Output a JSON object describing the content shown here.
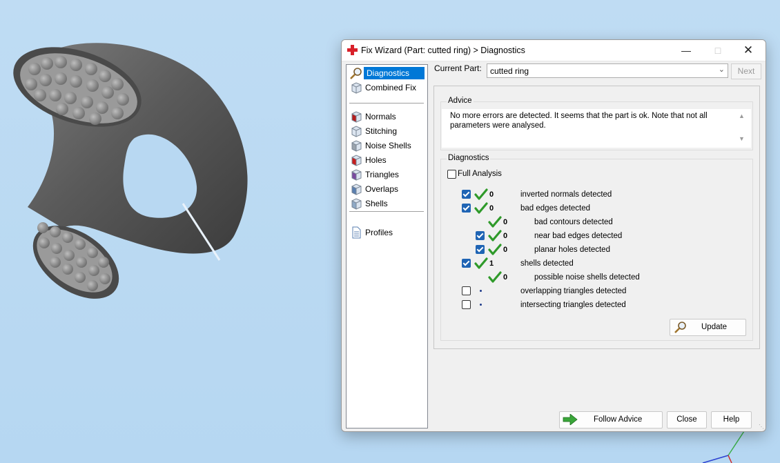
{
  "window": {
    "title": "Fix Wizard (Part: cutted ring) > Diagnostics",
    "icons": {
      "app": "red-cross-icon",
      "minimize": "minimize-icon",
      "maximize": "maximize-icon",
      "close": "close-icon"
    }
  },
  "nav": {
    "groups": [
      [
        {
          "label": "Diagnostics",
          "icon": "magnifier-icon",
          "active": true
        },
        {
          "label": "Combined Fix",
          "icon": "cube-icon"
        }
      ],
      [
        {
          "label": "Normals",
          "icon": "normals-cube-icon"
        },
        {
          "label": "Stitching",
          "icon": "stitching-cube-icon"
        },
        {
          "label": "Noise Shells",
          "icon": "noise-shells-cube-icon"
        },
        {
          "label": "Holes",
          "icon": "holes-cube-icon"
        },
        {
          "label": "Triangles",
          "icon": "triangles-cube-icon"
        },
        {
          "label": "Overlaps",
          "icon": "overlaps-cube-icon"
        },
        {
          "label": "Shells",
          "icon": "shells-cube-icon"
        }
      ],
      [
        {
          "label": "Profiles",
          "icon": "document-icon"
        }
      ]
    ]
  },
  "current_part": {
    "label": "Current Part:",
    "value": "cutted ring",
    "next_label": "Next"
  },
  "advice": {
    "title": "Advice",
    "text": "No more errors are detected. It seems that the part is ok. Note that not all parameters were analysed."
  },
  "diagnostics": {
    "title": "Diagnostics",
    "full_analysis": {
      "label": "Full Analysis",
      "checked": false
    },
    "rows": [
      {
        "checked": true,
        "status": "ok",
        "count": "0",
        "label": "inverted normals detected"
      },
      {
        "checked": true,
        "status": "ok",
        "count": "0",
        "label": "bad edges detected"
      },
      {
        "checked": null,
        "status": "ok",
        "count": "0",
        "label": "bad contours detected",
        "sub": true
      },
      {
        "checked": true,
        "status": "ok",
        "count": "0",
        "label": "near bad edges detected",
        "sub": true
      },
      {
        "checked": true,
        "status": "ok",
        "count": "0",
        "label": "planar holes detected",
        "sub": true
      },
      {
        "checked": true,
        "status": "ok",
        "count": "1",
        "label": "shells detected"
      },
      {
        "checked": null,
        "status": "ok",
        "count": "0",
        "label": "possible noise shells detected",
        "sub": true
      },
      {
        "checked": false,
        "status": "pending",
        "count": "",
        "label": "overlapping triangles detected"
      },
      {
        "checked": false,
        "status": "pending",
        "count": "",
        "label": "intersecting triangles detected"
      }
    ],
    "update_label": "Update"
  },
  "buttons": {
    "follow_advice": "Follow Advice",
    "close": "Close",
    "help": "Help"
  },
  "colors": {
    "accent": "#0078d7",
    "check_green": "#3a9a2a",
    "viewport_bg": "#b6d7f2"
  }
}
